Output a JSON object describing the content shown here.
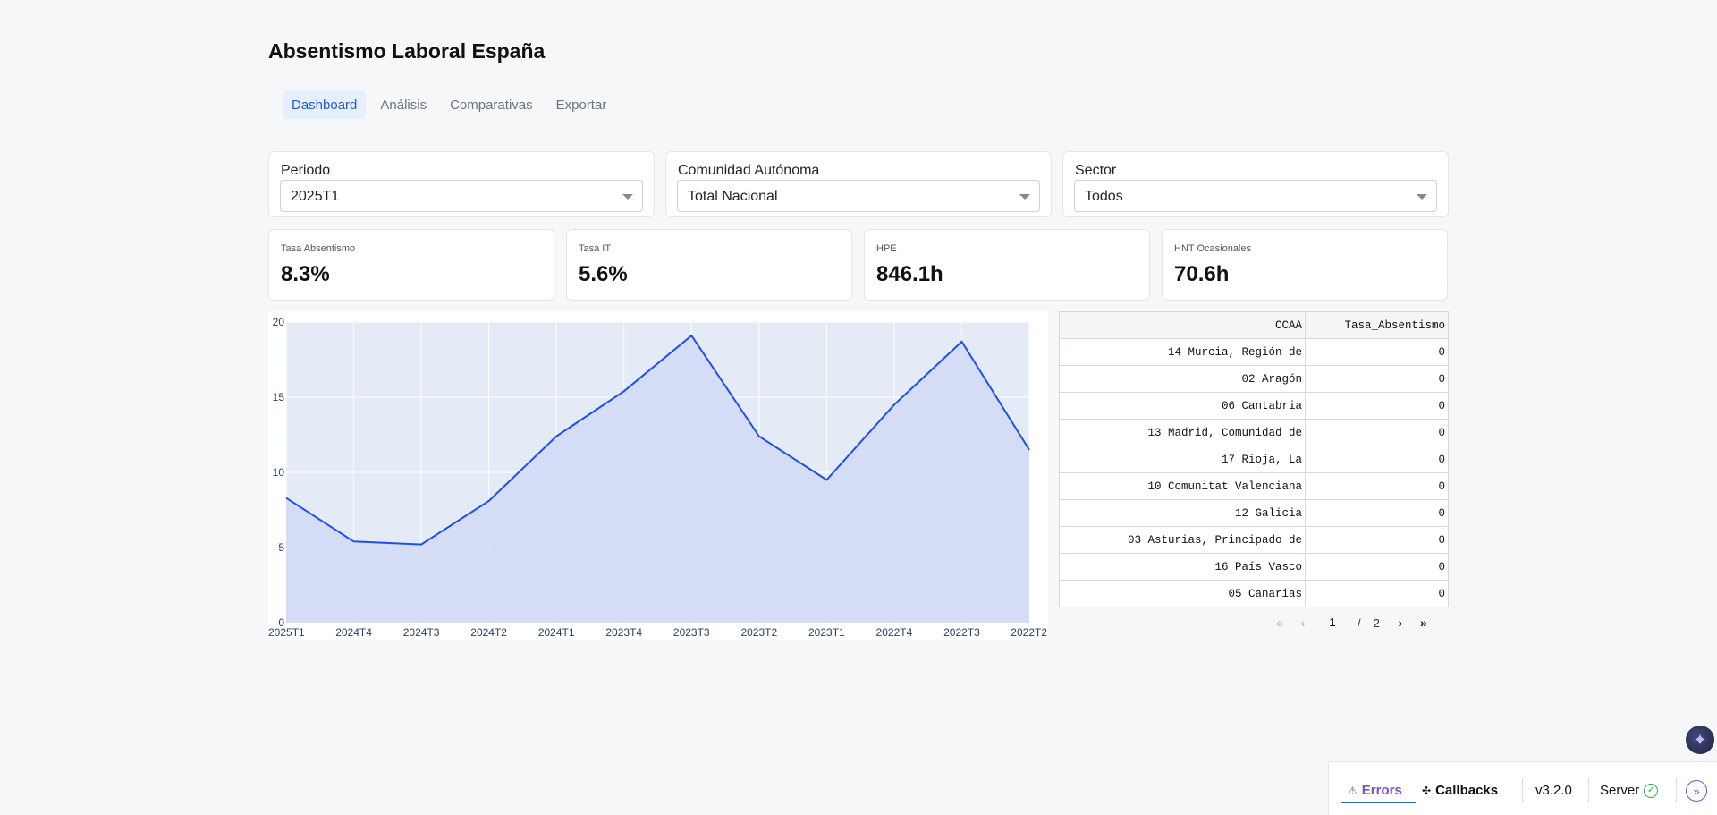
{
  "header": {
    "title": "Absentismo Laboral España"
  },
  "tabs": [
    {
      "label": "Dashboard",
      "active": true
    },
    {
      "label": "Análisis",
      "active": false
    },
    {
      "label": "Comparativas",
      "active": false
    },
    {
      "label": "Exportar",
      "active": false
    }
  ],
  "filters": {
    "periodo": {
      "label": "Periodo",
      "value": "2025T1"
    },
    "ccaa": {
      "label": "Comunidad Autónoma",
      "value": "Total Nacional"
    },
    "sector": {
      "label": "Sector",
      "value": "Todos"
    }
  },
  "kpis": [
    {
      "label": "Tasa Absentismo",
      "value": "8.3%"
    },
    {
      "label": "Tasa IT",
      "value": "5.6%"
    },
    {
      "label": "HPE",
      "value": "846.1h"
    },
    {
      "label": "HNT Ocasionales",
      "value": "70.6h"
    }
  ],
  "chart_data": {
    "type": "area",
    "x": [
      "2025T1",
      "2024T4",
      "2024T3",
      "2024T2",
      "2024T1",
      "2023T4",
      "2023T3",
      "2023T2",
      "2023T1",
      "2022T4",
      "2022T3",
      "2022T2"
    ],
    "y": [
      8.3,
      5.4,
      5.2,
      8.1,
      12.4,
      15.4,
      19.1,
      12.4,
      9.5,
      14.5,
      18.7,
      11.5
    ],
    "yticks": [
      "0",
      "5",
      "10",
      "15",
      "20"
    ],
    "ylim": [
      0,
      20
    ],
    "grid": true,
    "colors": {
      "line": "#1f4fe8",
      "fill": "#d3dcf6",
      "plot_bg": "#e5ebf6"
    }
  },
  "table": {
    "columns": [
      "CCAA",
      "Tasa_Absentismo"
    ],
    "rows": [
      [
        "14 Murcia, Región de",
        "0"
      ],
      [
        "02 Aragón",
        "0"
      ],
      [
        "06 Cantabria",
        "0"
      ],
      [
        "13 Madrid, Comunidad de",
        "0"
      ],
      [
        "17 Rioja, La",
        "0"
      ],
      [
        "10 Comunitat Valenciana",
        "0"
      ],
      [
        "12 Galicia",
        "0"
      ],
      [
        "03 Asturias, Principado de",
        "0"
      ],
      [
        "16 País Vasco",
        "0"
      ],
      [
        "05 Canarias",
        "0"
      ]
    ]
  },
  "pagination": {
    "current": "1",
    "separator": "/",
    "total": "2"
  },
  "devtools": {
    "errors_label": "Errors",
    "callbacks_label": "Callbacks",
    "version": "v3.2.0",
    "server_label": "Server"
  }
}
